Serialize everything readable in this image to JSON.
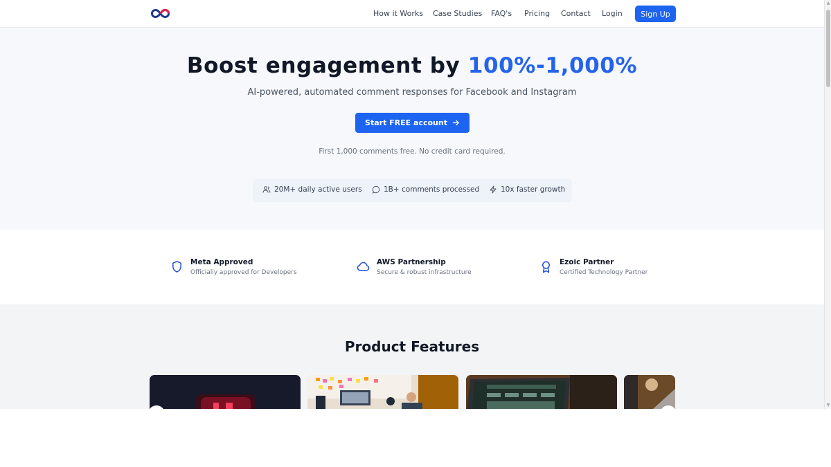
{
  "nav": {
    "links": [
      "How it Works",
      "Case Studies",
      "FAQ's",
      "Pricing",
      "Contact",
      "Login"
    ],
    "signup": "Sign Up"
  },
  "hero": {
    "title_main": "Boost engagement by",
    "title_accent": "100%-1,000%",
    "subtitle": "AI-powered, automated comment responses for Facebook and Instagram",
    "cta": "Start FREE account",
    "note": "First 1,000 comments free. No credit card required."
  },
  "stats": [
    {
      "icon": "users-icon",
      "label": "20M+ daily active users"
    },
    {
      "icon": "message-circle-icon",
      "label": "1B+ comments processed"
    },
    {
      "icon": "lightning-icon",
      "label": "10x faster growth"
    }
  ],
  "trust": [
    {
      "icon": "shield-icon",
      "title": "Meta Approved",
      "desc": "Officially approved for Developers"
    },
    {
      "icon": "cloud-icon",
      "title": "AWS Partnership",
      "desc": "Secure & robust infrastructure"
    },
    {
      "icon": "award-icon",
      "title": "Ezoic Partner",
      "desc": "Certified Technology Partner"
    }
  ],
  "features": {
    "title": "Product Features"
  },
  "colors": {
    "accent": "#2563eb",
    "button": "#1d64f0"
  }
}
